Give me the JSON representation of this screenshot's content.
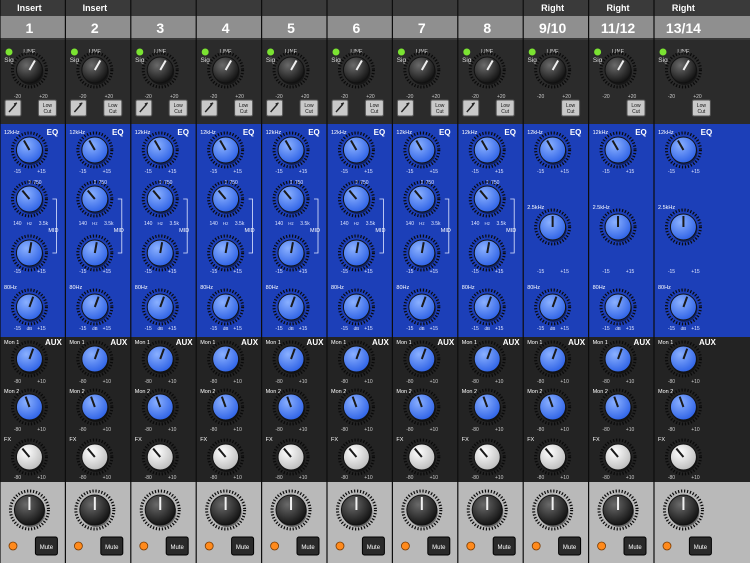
{
  "channels": [
    {
      "number": "1",
      "top_label": "Insert",
      "type": "mono"
    },
    {
      "number": "2",
      "top_label": "Insert",
      "type": "mono"
    },
    {
      "number": "3",
      "top_label": "",
      "type": "mono"
    },
    {
      "number": "4",
      "top_label": "",
      "type": "mono"
    },
    {
      "number": "5",
      "top_label": "",
      "type": "mono"
    },
    {
      "number": "6",
      "top_label": "",
      "type": "mono"
    },
    {
      "number": "7",
      "top_label": "",
      "type": "mono"
    },
    {
      "number": "8",
      "top_label": "",
      "type": "mono"
    },
    {
      "number": "9/10",
      "top_label": "Right",
      "type": "stereo"
    },
    {
      "number": "11/12",
      "top_label": "Right",
      "type": "stereo"
    },
    {
      "number": "13/14",
      "top_label": "Right",
      "type": "stereo"
    }
  ],
  "labels": {
    "sig": "Sig",
    "line": "LINE",
    "gain_min": "-20",
    "gain_max": "+20",
    "low_cut": "Low Cut",
    "eq": "EQ",
    "eq_high": "12kHz",
    "eq_mid_freq_center": "750",
    "eq_mid_freq_min": "140",
    "eq_mid_freq_max": "3.5k",
    "eq_mid_freq_unit": "Hz",
    "eq_mid": "MID",
    "eq_stereo_mid": "2.5kHz",
    "eq_low": "80Hz",
    "eq_zero": "0",
    "eq_min": "-15",
    "eq_max": "+15",
    "eq_unit": "dB",
    "aux": "AUX",
    "mon1": "Mon 1",
    "mon2": "Mon 2",
    "fx": "FX",
    "aux_min": "-80",
    "aux_max": "+10",
    "aux_unit": "dB",
    "mute": "Mute"
  },
  "colors": {
    "eq_section": "#1c3fb8",
    "eq_knob": "#2f63e6",
    "aux_section": "#232323",
    "fx_knob": "#e8e8e8",
    "header_strip": "#8f8f8f",
    "signal_led": "#7be332",
    "mute_led": "#ff8a1c",
    "top_section": "#2b2b2b",
    "bottom_section": "#b9b9b9"
  }
}
